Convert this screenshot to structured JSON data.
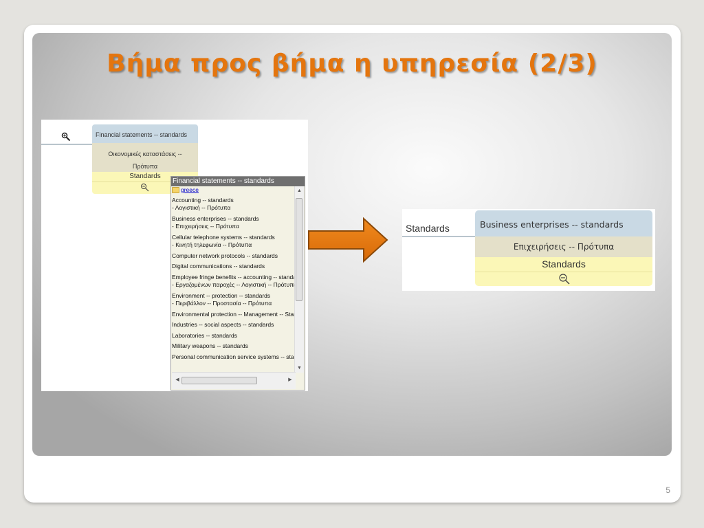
{
  "slide": {
    "title": "Βήμα προς βήμα η υπηρεσία (2/3)",
    "page_number": "5"
  },
  "left_screenshot": {
    "card": {
      "header": "Financial statements -- standards",
      "greek_line1": "Οικονομικές καταστάσεις --",
      "greek_line2": "Πρότυπα",
      "standards": "Standards"
    },
    "popup": {
      "header": "Financial statements -- standards",
      "folder_link": "greece",
      "items": [
        {
          "line1": "Accounting -- standards",
          "line2": "- Λογιστική -- Πρότυπα"
        },
        {
          "line1": "Business enterprises -- standards",
          "line2": "- Επιχειρήσεις -- Πρότυπα"
        },
        {
          "line1": "Cellular telephone systems -- standards",
          "line2": "- Κινητή τηλεφωνία -- Πρότυπα"
        },
        {
          "line1": "Computer network protocols -- standards",
          "line2": ""
        },
        {
          "line1": "Digital communications -- standards",
          "line2": ""
        },
        {
          "line1": "Employee fringe benefits -- accounting -- standards",
          "line2": "- Εργαζομένων παροχές -- Λογιστική -- Πρότυπα"
        },
        {
          "line1": "Environment -- protection -- standards",
          "line2": "- Περιβάλλον -- Προστασία -- Πρότυπα"
        },
        {
          "line1": "Environmental protection -- Management -- Standards",
          "line2": ""
        },
        {
          "line1": "Industries -- social aspects -- standards",
          "line2": ""
        },
        {
          "line1": "Laboratories -- standards",
          "line2": ""
        },
        {
          "line1": "Military weapons -- standards",
          "line2": ""
        },
        {
          "line1": "Personal communication service systems -- standards",
          "line2": ""
        }
      ],
      "hscroll_grip": "III",
      "vscroll_grip": "≡"
    }
  },
  "right_screenshot": {
    "left_label": "Standards",
    "card": {
      "header": "Business enterprises -- standards",
      "greek": "Επιχειρήσεις -- Πρότυπα",
      "standards": "Standards"
    }
  },
  "icons": {
    "zoom_in": "zoom-in-icon",
    "zoom_out": "zoom-out-icon",
    "arrow": "right-arrow-icon",
    "folder": "folder-icon"
  },
  "colors": {
    "title": "#e4750e",
    "arrow_fill": "#e4750e",
    "arrow_stroke": "#8b4a0a",
    "card_header": "#c9d9e4",
    "card_greek": "#e4e0c9",
    "card_standards": "#fbf7b7"
  }
}
